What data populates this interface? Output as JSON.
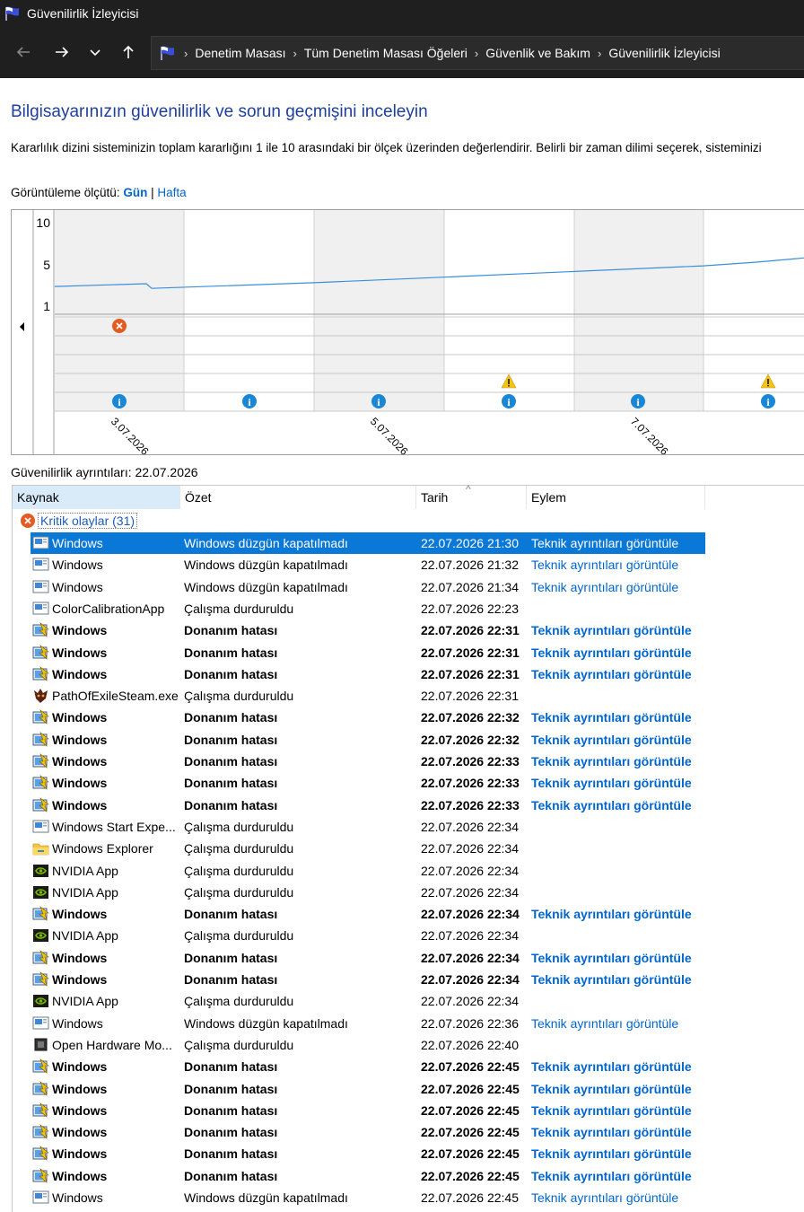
{
  "window": {
    "title": "Güvenilirlik İzleyicisi"
  },
  "breadcrumb": [
    "Denetim Masası",
    "Tüm Denetim Masası Öğeleri",
    "Güvenlik ve Bakım",
    "Güvenilirlik İzleyicisi"
  ],
  "heading": "Bilgisayarınızın güvenilirlik ve sorun geçmişini inceleyin",
  "description": "Kararlılık dizini sisteminizin toplam kararlığını 1 ile 10 arasındaki bir ölçek üzerinden değerlendirir. Belirli bir zaman dilimi seçerek, sisteminizi",
  "view_by": {
    "label": "Görüntüleme ölçütü:",
    "day": "Gün",
    "separator": "|",
    "week": "Hafta"
  },
  "chart": {
    "y_ticks": [
      "10",
      "5",
      "1"
    ],
    "x_labels": [
      "3.07.2026",
      "5.07.2026",
      "7.07.2026"
    ],
    "stability_index": [
      3.0,
      3.3,
      2.8,
      3.4,
      4.0,
      4.6,
      5.2,
      5.6,
      6.1
    ]
  },
  "details_label": "Güvenilirlik ayrıntıları: 22.07.2026",
  "table": {
    "headers": {
      "source": "Kaynak",
      "summary": "Özet",
      "date": "Tarih",
      "action": "Eylem"
    },
    "group_label": "Kritik olaylar (31)",
    "rows": [
      {
        "icon": "monitor",
        "source": "Windows",
        "summary": "Windows düzgün kapatılmadı",
        "date": "22.07.2026 21:30",
        "action": "Teknik ayrıntıları görüntüle",
        "bold": false,
        "selected": true
      },
      {
        "icon": "monitor",
        "source": "Windows",
        "summary": "Windows düzgün kapatılmadı",
        "date": "22.07.2026 21:32",
        "action": "Teknik ayrıntıları görüntüle",
        "bold": false
      },
      {
        "icon": "monitor",
        "source": "Windows",
        "summary": "Windows düzgün kapatılmadı",
        "date": "22.07.2026 21:34",
        "action": "Teknik ayrıntıları görüntüle",
        "bold": false
      },
      {
        "icon": "monitor",
        "source": "ColorCalibrationApp",
        "summary": "Çalışma durduruldu",
        "date": "22.07.2026 22:23",
        "action": "",
        "bold": false
      },
      {
        "icon": "hardware",
        "source": "Windows",
        "summary": "Donanım hatası",
        "date": "22.07.2026 22:31",
        "action": "Teknik ayrıntıları görüntüle",
        "bold": true
      },
      {
        "icon": "hardware",
        "source": "Windows",
        "summary": "Donanım hatası",
        "date": "22.07.2026 22:31",
        "action": "Teknik ayrıntıları görüntüle",
        "bold": true
      },
      {
        "icon": "hardware",
        "source": "Windows",
        "summary": "Donanım hatası",
        "date": "22.07.2026 22:31",
        "action": "Teknik ayrıntıları görüntüle",
        "bold": true
      },
      {
        "icon": "poe",
        "source": "PathOfExileSteam.exe",
        "summary": "Çalışma durduruldu",
        "date": "22.07.2026 22:31",
        "action": "",
        "bold": false
      },
      {
        "icon": "hardware",
        "source": "Windows",
        "summary": "Donanım hatası",
        "date": "22.07.2026 22:32",
        "action": "Teknik ayrıntıları görüntüle",
        "bold": true
      },
      {
        "icon": "hardware",
        "source": "Windows",
        "summary": "Donanım hatası",
        "date": "22.07.2026 22:32",
        "action": "Teknik ayrıntıları görüntüle",
        "bold": true
      },
      {
        "icon": "hardware",
        "source": "Windows",
        "summary": "Donanım hatası",
        "date": "22.07.2026 22:33",
        "action": "Teknik ayrıntıları görüntüle",
        "bold": true
      },
      {
        "icon": "hardware",
        "source": "Windows",
        "summary": "Donanım hatası",
        "date": "22.07.2026 22:33",
        "action": "Teknik ayrıntıları görüntüle",
        "bold": true
      },
      {
        "icon": "hardware",
        "source": "Windows",
        "summary": "Donanım hatası",
        "date": "22.07.2026 22:33",
        "action": "Teknik ayrıntıları görüntüle",
        "bold": true
      },
      {
        "icon": "monitor",
        "source": "Windows Start Expe...",
        "summary": "Çalışma durduruldu",
        "date": "22.07.2026 22:34",
        "action": "",
        "bold": false
      },
      {
        "icon": "folder",
        "source": "Windows Explorer",
        "summary": "Çalışma durduruldu",
        "date": "22.07.2026 22:34",
        "action": "",
        "bold": false
      },
      {
        "icon": "nvidia",
        "source": "NVIDIA App",
        "summary": "Çalışma durduruldu",
        "date": "22.07.2026 22:34",
        "action": "",
        "bold": false
      },
      {
        "icon": "nvidia",
        "source": "NVIDIA App",
        "summary": "Çalışma durduruldu",
        "date": "22.07.2026 22:34",
        "action": "",
        "bold": false
      },
      {
        "icon": "hardware",
        "source": "Windows",
        "summary": "Donanım hatası",
        "date": "22.07.2026 22:34",
        "action": "Teknik ayrıntıları görüntüle",
        "bold": true
      },
      {
        "icon": "nvidia",
        "source": "NVIDIA App",
        "summary": "Çalışma durduruldu",
        "date": "22.07.2026 22:34",
        "action": "",
        "bold": false
      },
      {
        "icon": "hardware",
        "source": "Windows",
        "summary": "Donanım hatası",
        "date": "22.07.2026 22:34",
        "action": "Teknik ayrıntıları görüntüle",
        "bold": true
      },
      {
        "icon": "hardware",
        "source": "Windows",
        "summary": "Donanım hatası",
        "date": "22.07.2026 22:34",
        "action": "Teknik ayrıntıları görüntüle",
        "bold": true
      },
      {
        "icon": "nvidia",
        "source": "NVIDIA App",
        "summary": "Çalışma durduruldu",
        "date": "22.07.2026 22:34",
        "action": "",
        "bold": false
      },
      {
        "icon": "monitor",
        "source": "Windows",
        "summary": "Windows düzgün kapatılmadı",
        "date": "22.07.2026 22:36",
        "action": "Teknik ayrıntıları görüntüle",
        "bold": false
      },
      {
        "icon": "chip",
        "source": "Open Hardware Mo...",
        "summary": "Çalışma durduruldu",
        "date": "22.07.2026 22:40",
        "action": "",
        "bold": false
      },
      {
        "icon": "hardware",
        "source": "Windows",
        "summary": "Donanım hatası",
        "date": "22.07.2026 22:45",
        "action": "Teknik ayrıntıları görüntüle",
        "bold": true
      },
      {
        "icon": "hardware",
        "source": "Windows",
        "summary": "Donanım hatası",
        "date": "22.07.2026 22:45",
        "action": "Teknik ayrıntıları görüntüle",
        "bold": true
      },
      {
        "icon": "hardware",
        "source": "Windows",
        "summary": "Donanım hatası",
        "date": "22.07.2026 22:45",
        "action": "Teknik ayrıntıları görüntüle",
        "bold": true
      },
      {
        "icon": "hardware",
        "source": "Windows",
        "summary": "Donanım hatası",
        "date": "22.07.2026 22:45",
        "action": "Teknik ayrıntıları görüntüle",
        "bold": true
      },
      {
        "icon": "hardware",
        "source": "Windows",
        "summary": "Donanım hatası",
        "date": "22.07.2026 22:45",
        "action": "Teknik ayrıntıları görüntüle",
        "bold": true
      },
      {
        "icon": "hardware",
        "source": "Windows",
        "summary": "Donanım hatası",
        "date": "22.07.2026 22:45",
        "action": "Teknik ayrıntıları görüntüle",
        "bold": true
      },
      {
        "icon": "monitor",
        "source": "Windows",
        "summary": "Windows düzgün kapatılmadı",
        "date": "22.07.2026 22:45",
        "action": "Teknik ayrıntıları görüntüle",
        "bold": false
      }
    ]
  },
  "colors": {
    "accent": "#0066cc",
    "selection": "#0a78d7",
    "heading": "#1e3f9a",
    "error": "#e35b24",
    "info": "#1a86d6",
    "warning": "#f3c318"
  }
}
